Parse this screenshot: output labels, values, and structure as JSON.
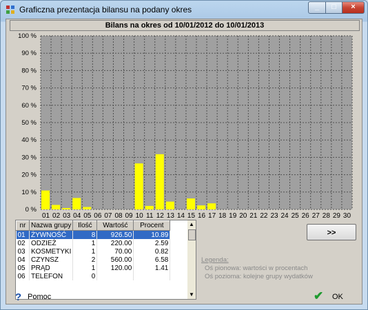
{
  "window": {
    "title": "Graficzna prezentacja bilansu na podany okres",
    "icon": "app-icon",
    "minimize": "minimize-icon",
    "maximize": "maximize-icon",
    "close": "close-icon"
  },
  "chart_data": {
    "type": "bar",
    "title": "Bilans na okres od 10/01/2012 do 10/01/2013",
    "categories": [
      "01",
      "02",
      "03",
      "04",
      "05",
      "06",
      "07",
      "08",
      "09",
      "10",
      "11",
      "12",
      "13",
      "14",
      "15",
      "16",
      "17",
      "18",
      "19",
      "20",
      "21",
      "22",
      "23",
      "24",
      "25",
      "26",
      "27",
      "28",
      "29",
      "30"
    ],
    "values": [
      10.89,
      2.59,
      0.82,
      6.58,
      1.41,
      0,
      0,
      0,
      0,
      26.5,
      2.0,
      31.8,
      4.5,
      0,
      6.3,
      2.3,
      3.5,
      0,
      0,
      0,
      0,
      0,
      0,
      0,
      0,
      0,
      0,
      0,
      0,
      0
    ],
    "ylim": [
      0,
      100
    ],
    "yticks": [
      "0 %",
      "10 %",
      "20 %",
      "30 %",
      "40 %",
      "50 %",
      "60 %",
      "70 %",
      "80 %",
      "90 %",
      "100 %"
    ],
    "grid": true,
    "bar_color": "#ffff00",
    "background": "#a0a0a0"
  },
  "table": {
    "headers": [
      "nr",
      "Nazwa grupy",
      "Ilość",
      "Wartość",
      "Procent"
    ],
    "rows": [
      {
        "nr": "01",
        "name": "ŻYWNOŚĆ",
        "qty": "8",
        "value": "926.50",
        "pct": "10.89"
      },
      {
        "nr": "02",
        "name": "ODZIEŻ",
        "qty": "1",
        "value": "220.00",
        "pct": "2.59"
      },
      {
        "nr": "03",
        "name": "KOSMETYKI",
        "qty": "1",
        "value": "70.00",
        "pct": "0.82"
      },
      {
        "nr": "04",
        "name": "CZYNSZ",
        "qty": "2",
        "value": "560.00",
        "pct": "6.58"
      },
      {
        "nr": "05",
        "name": "PRĄD",
        "qty": "1",
        "value": "120.00",
        "pct": "1.41"
      },
      {
        "nr": "06",
        "name": "TELEFON",
        "qty": "0",
        "value": "",
        "pct": ""
      }
    ],
    "selected_row": 0
  },
  "next_button": ">>",
  "legend": {
    "title": "Legenda:",
    "vertical": "Oś pionowa: wartości w procentach",
    "horizontal": "Oś pozioma: kolejne grupy wydatków"
  },
  "help": {
    "label": "Pomoc",
    "icon": "help-icon"
  },
  "ok": {
    "label": "OK",
    "icon": "check-icon"
  },
  "colors": {
    "selection": "#316ac5",
    "accent": "#1d9a2e"
  }
}
